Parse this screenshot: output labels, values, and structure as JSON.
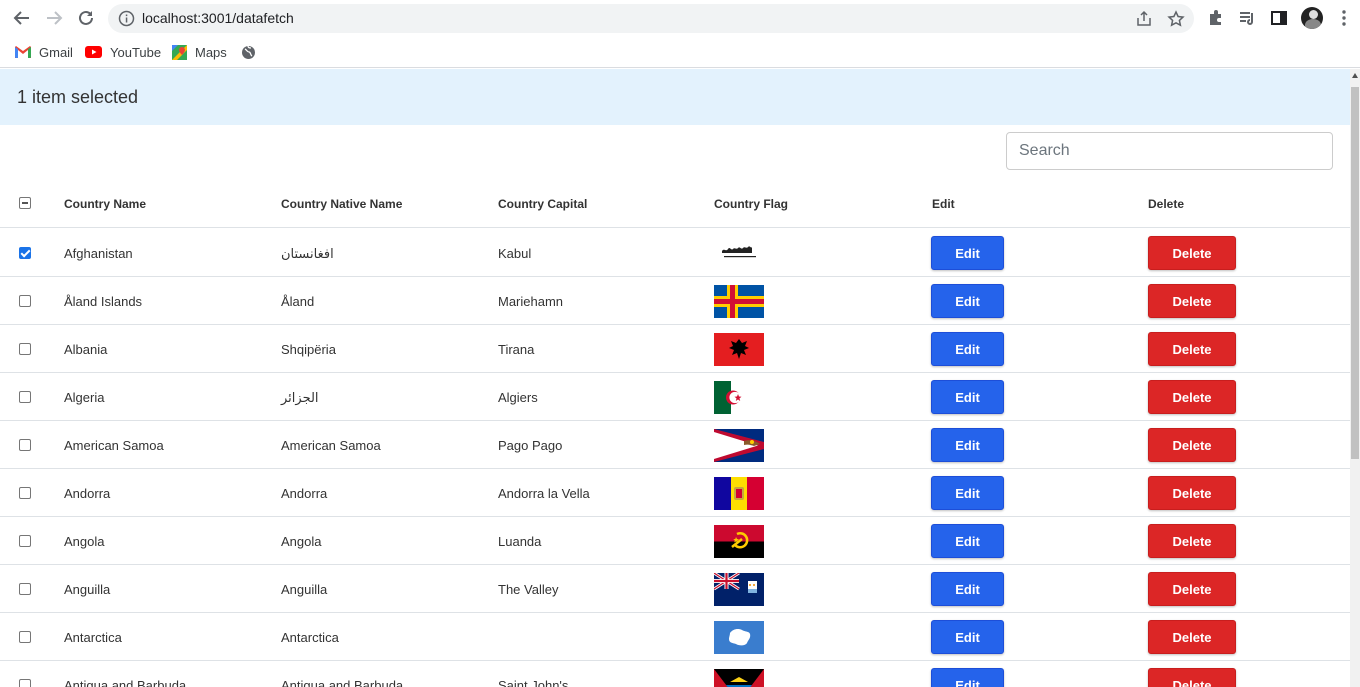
{
  "browser": {
    "url": "localhost:3001/datafetch",
    "bookmarks": [
      {
        "label": "Gmail",
        "icon": "gmail-icon"
      },
      {
        "label": "YouTube",
        "icon": "youtube-icon"
      },
      {
        "label": "Maps",
        "icon": "maps-icon"
      }
    ]
  },
  "selection": {
    "text": "1 item selected"
  },
  "search": {
    "placeholder": "Search",
    "value": ""
  },
  "table": {
    "headers": [
      "Country Name",
      "Country Native Name",
      "Country Capital",
      "Country Flag",
      "Edit",
      "Delete"
    ],
    "edit_label": "Edit",
    "delete_label": "Delete",
    "rows": [
      {
        "name": "Afghanistan",
        "native": "افغانستان",
        "capital": "Kabul",
        "flag": "afghanistan-flag-icon",
        "checked": true
      },
      {
        "name": "Åland Islands",
        "native": "Åland",
        "capital": "Mariehamn",
        "flag": "aland-flag-icon",
        "checked": false
      },
      {
        "name": "Albania",
        "native": "Shqipëria",
        "capital": "Tirana",
        "flag": "albania-flag-icon",
        "checked": false
      },
      {
        "name": "Algeria",
        "native": "الجزائر",
        "capital": "Algiers",
        "flag": "algeria-flag-icon",
        "checked": false
      },
      {
        "name": "American Samoa",
        "native": "American Samoa",
        "capital": "Pago Pago",
        "flag": "american-samoa-flag-icon",
        "checked": false
      },
      {
        "name": "Andorra",
        "native": "Andorra",
        "capital": "Andorra la Vella",
        "flag": "andorra-flag-icon",
        "checked": false
      },
      {
        "name": "Angola",
        "native": "Angola",
        "capital": "Luanda",
        "flag": "angola-flag-icon",
        "checked": false
      },
      {
        "name": "Anguilla",
        "native": "Anguilla",
        "capital": "The Valley",
        "flag": "anguilla-flag-icon",
        "checked": false
      },
      {
        "name": "Antarctica",
        "native": "Antarctica",
        "capital": "",
        "flag": "antarctica-flag-icon",
        "checked": false
      },
      {
        "name": "Antigua and Barbuda",
        "native": "Antigua and Barbuda",
        "capital": "Saint John's",
        "flag": "antigua-flag-icon",
        "checked": false
      }
    ]
  },
  "colors": {
    "selection_bar": "#e3f2fd",
    "edit": "#2563eb",
    "delete": "#dc2626"
  }
}
